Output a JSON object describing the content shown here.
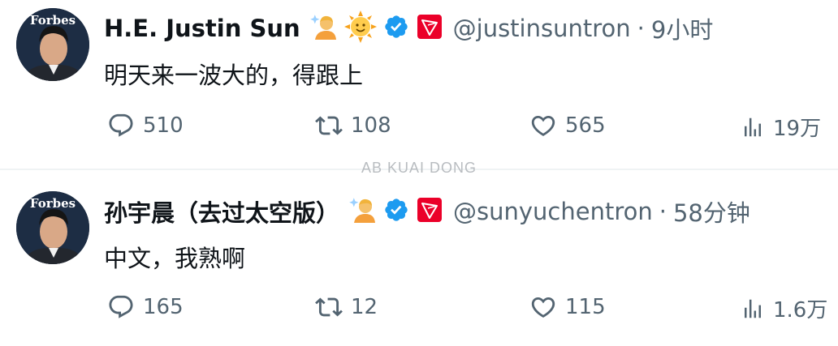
{
  "watermark": "AB KUAI DONG",
  "tweets": [
    {
      "author_name": "H.E. Justin Sun",
      "avatar_label": "Forbes",
      "emoji": [
        "person-with-sparkles-emoji",
        "sun-emoji"
      ],
      "handle": "@justinsuntron",
      "separator": "·",
      "time": "9小时",
      "text": "明天来一波大的，得跟上",
      "replies": "510",
      "retweets": "108",
      "likes": "565",
      "views": "19万"
    },
    {
      "author_name": "孙宇晨（去过太空版）",
      "avatar_label": "Forbes",
      "emoji": [
        "person-with-sparkles-emoji"
      ],
      "handle": "@sunyuchentron",
      "separator": "·",
      "time": "58分钟",
      "text": "中文，我熟啊",
      "replies": "165",
      "retweets": "12",
      "likes": "115",
      "views": "1.6万"
    }
  ],
  "colors": {
    "text": "#0f1419",
    "secondary": "#536471",
    "verified": "#1d9bf0",
    "tron": "#eb0029",
    "divider": "#eff3f4"
  }
}
